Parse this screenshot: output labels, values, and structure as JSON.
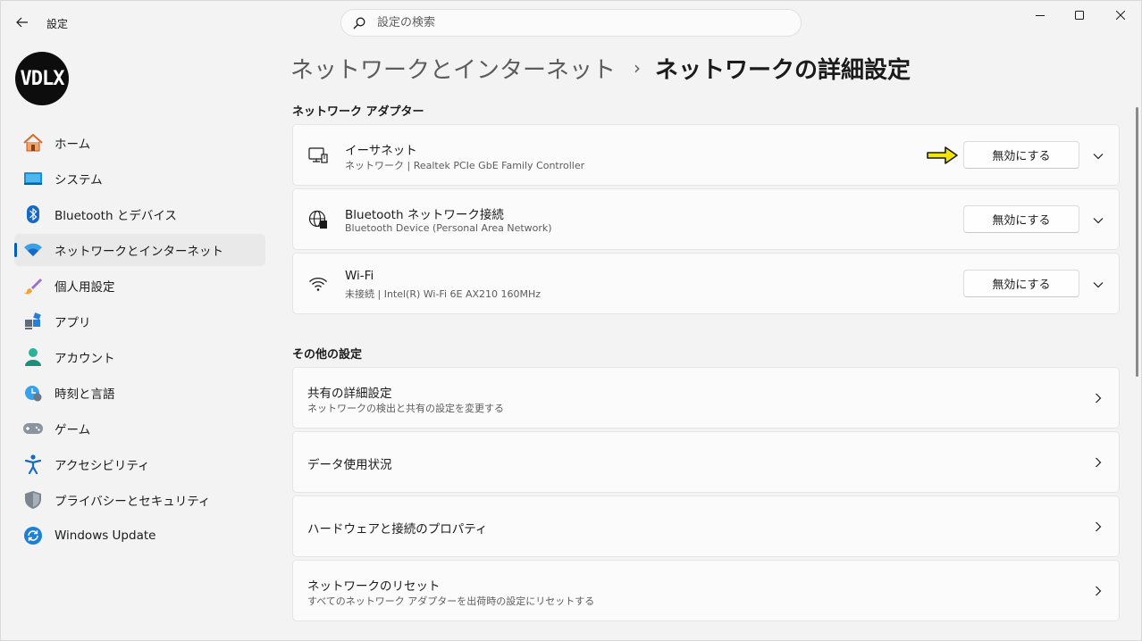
{
  "window": {
    "title": "設定",
    "controls": {
      "minimize_icon": "minimize-icon",
      "maximize_icon": "maximize-icon",
      "close_icon": "close-icon"
    }
  },
  "search": {
    "placeholder": "設定の検索",
    "value": ""
  },
  "user": {
    "avatar_text": "VDLX"
  },
  "sidebar": {
    "items": [
      {
        "label": "ホーム",
        "icon": "home-icon",
        "active": false
      },
      {
        "label": "システム",
        "icon": "system-icon",
        "active": false
      },
      {
        "label": "Bluetooth とデバイス",
        "icon": "bluetooth-icon",
        "active": false
      },
      {
        "label": "ネットワークとインターネット",
        "icon": "wifi-icon",
        "active": true
      },
      {
        "label": "個人用設定",
        "icon": "brush-icon",
        "active": false
      },
      {
        "label": "アプリ",
        "icon": "apps-icon",
        "active": false
      },
      {
        "label": "アカウント",
        "icon": "account-icon",
        "active": false
      },
      {
        "label": "時刻と言語",
        "icon": "time-language-icon",
        "active": false
      },
      {
        "label": "ゲーム",
        "icon": "gamepad-icon",
        "active": false
      },
      {
        "label": "アクセシビリティ",
        "icon": "accessibility-icon",
        "active": false
      },
      {
        "label": "プライバシーとセキュリティ",
        "icon": "shield-icon",
        "active": false
      },
      {
        "label": "Windows Update",
        "icon": "update-icon",
        "active": false
      }
    ]
  },
  "breadcrumb": {
    "parent": "ネットワークとインターネット",
    "separator": "›",
    "current": "ネットワークの詳細設定"
  },
  "adapters_section": {
    "title": "ネットワーク アダプター",
    "items": [
      {
        "name": "イーサネット",
        "description": "ネットワーク | Realtek PCIe GbE Family Controller",
        "button": "無効にする",
        "icon": "ethernet-icon"
      },
      {
        "name": "Bluetooth ネットワーク接続",
        "description": "Bluetooth Device (Personal Area Network)",
        "button": "無効にする",
        "icon": "globe-network-icon"
      },
      {
        "name": "Wi-Fi",
        "description": "未接続 | Intel(R) Wi-Fi 6E AX210 160MHz",
        "button": "無効にする",
        "icon": "wifi-icon"
      }
    ]
  },
  "other_section": {
    "title": "その他の設定",
    "items": [
      {
        "title": "共有の詳細設定",
        "subtitle": "ネットワークの検出と共有の設定を変更する"
      },
      {
        "title": "データ使用状況",
        "subtitle": ""
      },
      {
        "title": "ハードウェアと接続のプロパティ",
        "subtitle": ""
      },
      {
        "title": "ネットワークのリセット",
        "subtitle": "すべてのネットワーク アダプターを出荷時の設定にリセットする"
      }
    ]
  },
  "colors": {
    "accent": "#005fb8",
    "annotation_arrow": "#f5e600"
  }
}
